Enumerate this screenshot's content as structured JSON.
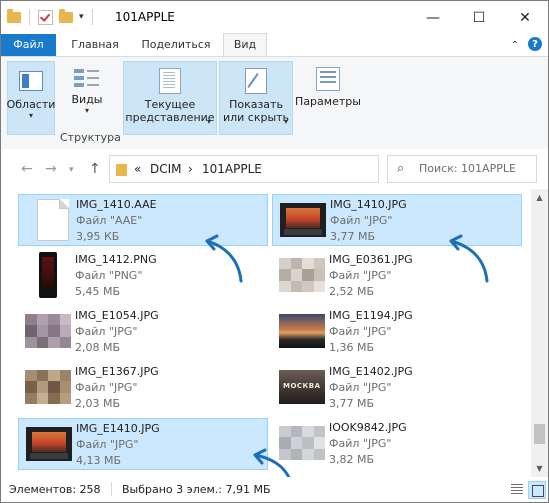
{
  "window": {
    "title": "101APPLE",
    "minimize": "—",
    "maximize": "☐",
    "close": "✕"
  },
  "ribbon": {
    "tabs": [
      {
        "label": "Файл"
      },
      {
        "label": "Главная"
      },
      {
        "label": "Поделиться"
      },
      {
        "label": "Вид"
      }
    ],
    "groups": {
      "panes": {
        "label": "Области"
      },
      "views": {
        "label": "Виды"
      },
      "structure": {
        "caption": "Структура"
      },
      "current_view": {
        "line1": "Текущее",
        "line2": "представление"
      },
      "show_hide": {
        "line1": "Показать",
        "line2": "или скрыть"
      },
      "options": {
        "label": "Параметры"
      }
    }
  },
  "address": {
    "crumbs": [
      "DCIM",
      "101APPLE"
    ],
    "separator": "›",
    "overflow": "«",
    "search_placeholder": "Поиск: 101APPLE"
  },
  "files": [
    {
      "name": "IMG_1410.AAE",
      "type": "Файл \"AAE\"",
      "size": "3,95 КБ",
      "selected": true,
      "thumb": "document"
    },
    {
      "name": "IMG_1410.JPG",
      "type": "Файл \"JPG\"",
      "size": "3,77 МБ",
      "selected": true,
      "thumb": "tv-photo"
    },
    {
      "name": "IMG_1412.PNG",
      "type": "Файл \"PNG\"",
      "size": "5,45 МБ",
      "selected": false,
      "thumb": "phone-screenshot"
    },
    {
      "name": "IMG_E0361.JPG",
      "type": "Файл \"JPG\"",
      "size": "2,52 МБ",
      "selected": false,
      "thumb": "mosaic"
    },
    {
      "name": "IMG_E1054.JPG",
      "type": "Файл \"JPG\"",
      "size": "2,08 МБ",
      "selected": false,
      "thumb": "mosaic"
    },
    {
      "name": "IMG_E1194.JPG",
      "type": "Файл \"JPG\"",
      "size": "1,36 МБ",
      "selected": false,
      "thumb": "sunset"
    },
    {
      "name": "IMG_E1367.JPG",
      "type": "Файл \"JPG\"",
      "size": "2,03 МБ",
      "selected": false,
      "thumb": "mosaic"
    },
    {
      "name": "IMG_E1402.JPG",
      "type": "Файл \"JPG\"",
      "size": "3,77 МБ",
      "selected": false,
      "thumb": "moscow-photo"
    },
    {
      "name": "IMG_E1410.JPG",
      "type": "Файл \"JPG\"",
      "size": "4,13 МБ",
      "selected": true,
      "thumb": "tv-photo"
    },
    {
      "name": "IOOK9842.JPG",
      "type": "Файл \"JPG\"",
      "size": "3,82 МБ",
      "selected": false,
      "thumb": "mosaic"
    }
  ],
  "status": {
    "items": "Элементов: 258",
    "selection": "Выбрано 3 элем.: 7,91 МБ"
  },
  "colors": {
    "accent": "#1979ca",
    "selection_bg": "#cce8ff",
    "selection_border": "#99d1ff",
    "annotation_arrow": "#1c6fb8"
  }
}
